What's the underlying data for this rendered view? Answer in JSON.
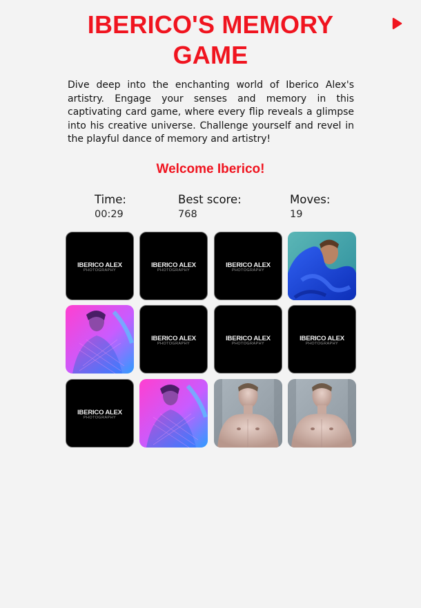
{
  "header": {
    "title": "IBERICO'S MEMORY GAME",
    "play_icon": "play-icon",
    "accent_color": "#f0141f"
  },
  "intro": {
    "description": "Dive deep into the enchanting world of Iberico Alex's artistry. Engage your senses and memory in this captivating card game, where every flip reveals a glimpse into his creative universe. Challenge yourself and revel in the playful dance of memory and artistry!"
  },
  "welcome": "Welcome Iberico!",
  "stats": {
    "time": {
      "label": "Time:",
      "value": "00:29"
    },
    "best_score": {
      "label": "Best score:",
      "value": "768"
    },
    "moves": {
      "label": "Moves:",
      "value": "19"
    }
  },
  "card_back": {
    "logo_main": "IBERICO ALEX",
    "logo_sub": "PHOTOGRAPHY"
  },
  "board": {
    "rows": 3,
    "cols": 4,
    "cards": [
      {
        "state": "hidden"
      },
      {
        "state": "hidden"
      },
      {
        "state": "hidden"
      },
      {
        "state": "revealed",
        "photo": "blue-hood-portrait"
      },
      {
        "state": "revealed",
        "photo": "pink-neon-portrait"
      },
      {
        "state": "hidden"
      },
      {
        "state": "hidden"
      },
      {
        "state": "hidden"
      },
      {
        "state": "hidden"
      },
      {
        "state": "revealed",
        "photo": "pink-neon-portrait"
      },
      {
        "state": "revealed",
        "photo": "shirtless-portrait"
      },
      {
        "state": "revealed",
        "photo": "shirtless-portrait"
      }
    ]
  }
}
